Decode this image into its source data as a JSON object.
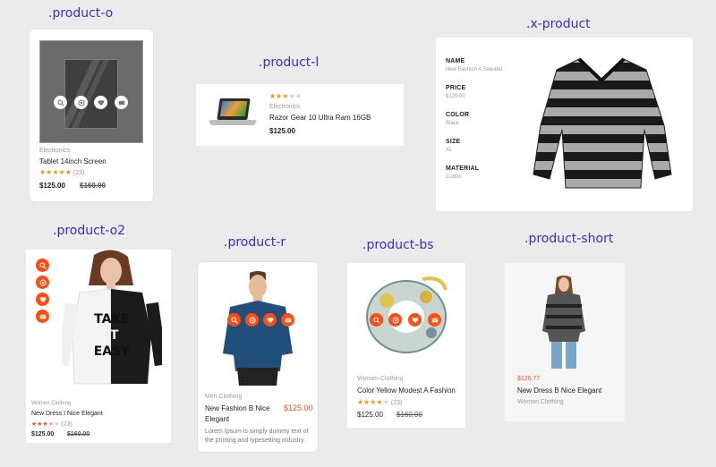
{
  "labels": {
    "product_o": ".product-o",
    "product_l": ".product-l",
    "x_product": ".x-product",
    "product_o2": ".product-o2",
    "product_r": ".product-r",
    "product_bs": ".product-bs",
    "product_short": ".product-short"
  },
  "product_o": {
    "category": "Electronics",
    "name": "Tablet 14inch Screen",
    "rating": 4.5,
    "reviews": "(23)",
    "price": "$125.00",
    "old_price": "$160.00",
    "icons": [
      "zoom-icon",
      "eye-icon",
      "heart-icon",
      "mail-icon"
    ]
  },
  "product_l": {
    "rating": 3,
    "category": "Electronics",
    "name": "Razor Gear 10 Ultra Ram 16GB",
    "price": "$125.00"
  },
  "x_product": {
    "specs": [
      {
        "key": "NAME",
        "value": "New Fashion A Sweater"
      },
      {
        "key": "PRICE",
        "value": "$125.00"
      },
      {
        "key": "COLOR",
        "value": "Black"
      },
      {
        "key": "SIZE",
        "value": "XL"
      },
      {
        "key": "MATERIAL",
        "value": "Cotton"
      }
    ]
  },
  "product_o2": {
    "category": "Women Clothing",
    "name": "New Dress I Nice Elegant",
    "rating": 3.5,
    "reviews": "(23)",
    "price": "$125.00",
    "old_price": "$160.00",
    "shirt_text": "TAKE IT EASY"
  },
  "product_r": {
    "category": "Men Clothing",
    "name_line1": "New Fashion B Nice",
    "name_line2": "Elegant",
    "price": "$125.00",
    "desc_line1": "Lorem Ipsum is simply dummy text of",
    "desc_line2": "the printing and typesetting industry."
  },
  "product_bs": {
    "category": "Women Clothing",
    "name": "Color Yellow Modest A Fashion",
    "rating": 4,
    "reviews": "(23)",
    "price": "$125.00",
    "old_price": "$160.00"
  },
  "product_short": {
    "price": "$126.77",
    "name": "New Dress B Nice Elegant",
    "category": "Women Clothing"
  },
  "colors": {
    "accent": "#ff4d12",
    "label": "#3d2cc8",
    "star": "#f2931b"
  }
}
